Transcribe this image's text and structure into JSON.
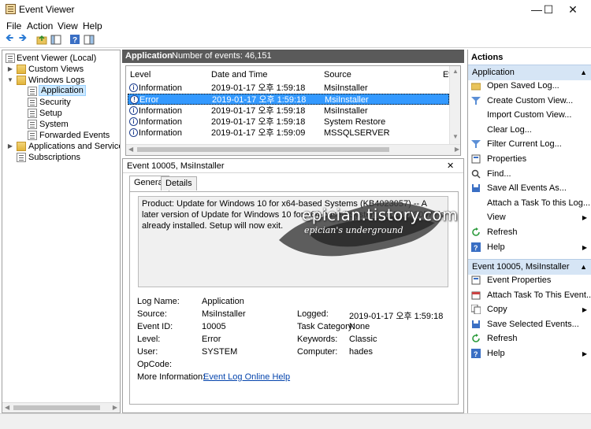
{
  "window": {
    "title": "Event Viewer",
    "minimize": "—",
    "maximize": "☐",
    "close": "✕"
  },
  "menu": [
    {
      "label": "File",
      "key": "F"
    },
    {
      "label": "Action",
      "key": "A"
    },
    {
      "label": "View",
      "key": "V"
    },
    {
      "label": "Help",
      "key": "H"
    }
  ],
  "tree": {
    "root": "Event Viewer (Local)",
    "custom_views": "Custom Views",
    "windows_logs": "Windows Logs",
    "application": "Application",
    "security": "Security",
    "setup": "Setup",
    "system": "System",
    "forwarded": "Forwarded Events",
    "apps_services": "Applications and Services Lo",
    "subscriptions": "Subscriptions"
  },
  "center": {
    "log_name": "Application",
    "event_count": "Number of events: 46,151",
    "columns": [
      "Level",
      "Date and Time",
      "Source",
      "Eve"
    ],
    "rows": [
      {
        "level": "Information",
        "date": "2019-01-17 오후 1:59:18",
        "source": "MsiInstaller",
        "type": "info"
      },
      {
        "level": "Error",
        "date": "2019-01-17 오후 1:59:18",
        "source": "MsiInstaller",
        "type": "error"
      },
      {
        "level": "Information",
        "date": "2019-01-17 오후 1:59:18",
        "source": "MsiInstaller",
        "type": "info"
      },
      {
        "level": "Information",
        "date": "2019-01-17 오후 1:59:18",
        "source": "System Restore",
        "type": "info"
      },
      {
        "level": "Information",
        "date": "2019-01-17 오후 1:59:09",
        "source": "MSSQLSERVER",
        "type": "info"
      }
    ]
  },
  "detail": {
    "title": "Event 10005, MsiInstaller",
    "tabs": [
      "General",
      "Details"
    ],
    "description": "Product: Update for Windows 10 for x64-based Systems (KB4023057) -- A later version of Update for Windows 10 for x64-based Systems (KB4023057) is already installed. Setup will now exit.",
    "fields": {
      "log_name_label": "Log Name:",
      "log_name": "Application",
      "source_label": "Source:",
      "source": "MsiInstaller",
      "logged_label": "Logged:",
      "logged": "2019-01-17 오후 1:59:18",
      "event_id_label": "Event ID:",
      "event_id": "10005",
      "task_category_label": "Task Category:",
      "task_category": "None",
      "level_label": "Level:",
      "level": "Error",
      "keywords_label": "Keywords:",
      "keywords": "Classic",
      "user_label": "User:",
      "user": "SYSTEM",
      "computer_label": "Computer:",
      "computer": "hades",
      "opcode_label": "OpCode:",
      "opcode": "",
      "more_info_label": "More Information:",
      "more_info_link": "Event Log Online Help"
    }
  },
  "watermark": {
    "text": "epician.tistory.com",
    "subtitle": "epician's underground"
  },
  "actions": {
    "title": "Actions",
    "section1": "Application",
    "items1": [
      {
        "label": "Open Saved Log...",
        "icon": "open-folder-icon",
        "sub": false
      },
      {
        "label": "Create Custom View...",
        "icon": "filter-icon",
        "sub": false
      },
      {
        "label": "Import Custom View...",
        "icon": "",
        "sub": false
      },
      {
        "label": "Clear Log...",
        "icon": "",
        "sub": false
      },
      {
        "label": "Filter Current Log...",
        "icon": "filter-icon",
        "sub": false
      },
      {
        "label": "Properties",
        "icon": "properties-icon",
        "sub": false
      },
      {
        "label": "Find...",
        "icon": "find-icon",
        "sub": false
      },
      {
        "label": "Save All Events As...",
        "icon": "save-icon",
        "sub": false
      },
      {
        "label": "Attach a Task To this Log...",
        "icon": "",
        "sub": false
      },
      {
        "label": "View",
        "icon": "",
        "sub": true
      },
      {
        "label": "Refresh",
        "icon": "refresh-icon",
        "sub": false
      },
      {
        "label": "Help",
        "icon": "help-icon",
        "sub": true
      }
    ],
    "section2": "Event 10005, MsiInstaller",
    "items2": [
      {
        "label": "Event Properties",
        "icon": "properties-icon",
        "sub": false
      },
      {
        "label": "Attach Task To This Event...",
        "icon": "task-icon",
        "sub": false
      },
      {
        "label": "Copy",
        "icon": "copy-icon",
        "sub": true
      },
      {
        "label": "Save Selected Events...",
        "icon": "save-icon",
        "sub": false
      },
      {
        "label": "Refresh",
        "icon": "refresh-icon",
        "sub": false
      },
      {
        "label": "Help",
        "icon": "help-icon",
        "sub": true
      }
    ]
  },
  "colors": {
    "selection": "#3399ff",
    "header": "#5a5a5a",
    "action_section": "#d6e5f5"
  }
}
